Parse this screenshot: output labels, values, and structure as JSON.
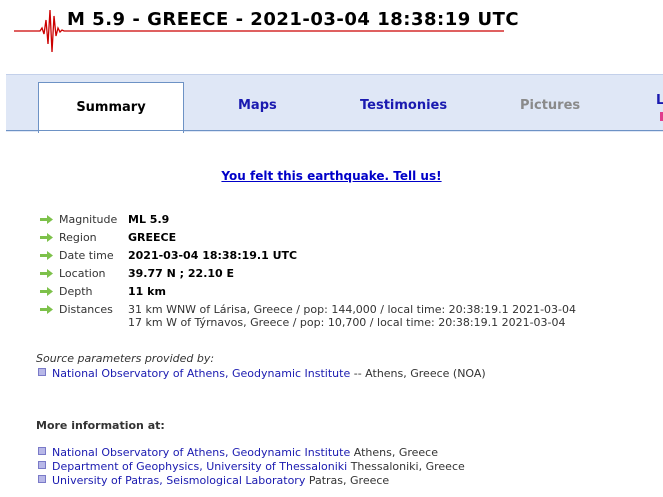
{
  "title": "M 5.9 - GREECE - 2021-03-04 18:38:19 UTC",
  "tabs": [
    {
      "label": "Summary"
    },
    {
      "label": "Maps"
    },
    {
      "label": "Testimonies"
    },
    {
      "label": "Pictures"
    },
    {
      "label": "L"
    }
  ],
  "felt_link": "You felt this earthquake. Tell us!",
  "params": [
    {
      "label": "Magnitude",
      "value": "ML 5.9"
    },
    {
      "label": "Region",
      "value": "GREECE"
    },
    {
      "label": "Date time",
      "value": "2021-03-04 18:38:19.1 UTC"
    },
    {
      "label": "Location",
      "value": "39.77 N ; 22.10 E"
    },
    {
      "label": "Depth",
      "value": "11 km"
    }
  ],
  "distances": {
    "label": "Distances",
    "lines": [
      "31 km WNW of Lárisa, Greece / pop: 144,000 / local time: 20:38:19.1 2021-03-04",
      "17 km W of Týrnavos, Greece / pop: 10,700 / local time: 20:38:19.1 2021-03-04"
    ]
  },
  "source": {
    "title": "Source parameters provided by:",
    "link": "National Observatory of Athens, Geodynamic Institute",
    "suffix": "-- Athens, Greece (NOA)"
  },
  "more": {
    "title": "More information at:",
    "items": [
      {
        "link": "National Observatory of Athens, Geodynamic Institute",
        "place": "Athens, Greece"
      },
      {
        "link": "Department of Geophysics, University of Thessaloniki",
        "place": "Thessaloniki, Greece"
      },
      {
        "link": "University of Patras, Seismological Laboratory",
        "place": "Patras, Greece"
      }
    ]
  },
  "colors": {
    "accent_red": "#cc0000",
    "link_blue": "#1a1ab0",
    "tab_bg": "#dfe7f6",
    "arrow_green": "#7dc14a"
  },
  "icons": {
    "logo": "seismogram-icon",
    "param_bullet": "green-arrow-icon",
    "list_bullet": "square-bullet-icon"
  }
}
